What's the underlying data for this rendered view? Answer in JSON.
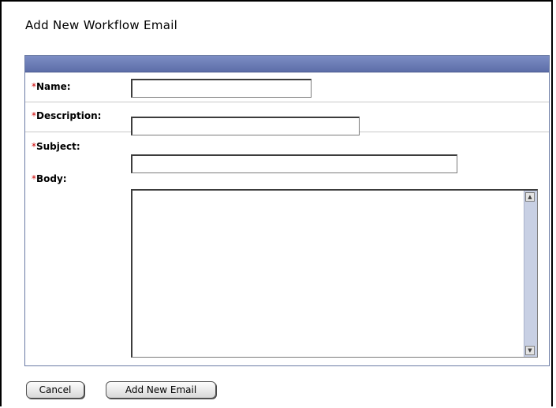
{
  "page": {
    "title": "Add New Workflow Email"
  },
  "form": {
    "required_marker": "*",
    "fields": {
      "name": {
        "label": "Name:",
        "value": ""
      },
      "description": {
        "label": "Description:",
        "value": ""
      },
      "subject": {
        "label": "Subject:",
        "value": ""
      },
      "body": {
        "label": "Body:",
        "value": ""
      }
    }
  },
  "actions": {
    "cancel_label": "Cancel",
    "add_label": "Add New Email"
  },
  "colors": {
    "header_bar": "#6a7bb6",
    "required": "#cc0000"
  }
}
